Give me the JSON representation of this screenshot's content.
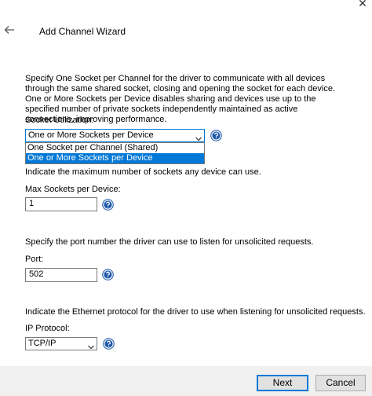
{
  "window": {
    "close_glyph": "✕"
  },
  "header": {
    "title": "Add Channel Wizard",
    "back_icon": "back-arrow-icon"
  },
  "socket_description": "Specify One Socket per Channel for the driver to communicate with all devices through the same shared socket, closing and opening the socket for each device. One or More Sockets per Device disables sharing and devices use up to the specified number of private sockets independently maintained as active connections, improving performance.",
  "socket_utilization": {
    "label": "Socket Utilization:",
    "selected": "One or More Sockets per Device",
    "options": [
      "One Socket per Channel (Shared)",
      "One or More Sockets per Device"
    ]
  },
  "max_sockets": {
    "description": "Indicate the maximum number of sockets any device can use.",
    "label": "Max Sockets per Device:",
    "value": "1"
  },
  "port": {
    "description": "Specify the port number the driver can use to listen for unsolicited requests.",
    "label": "Port:",
    "value": "502"
  },
  "ip_protocol": {
    "description": "Indicate the Ethernet protocol for the driver to use when listening for unsolicited requests.",
    "label": "IP Protocol:",
    "selected": "TCP/IP"
  },
  "footer": {
    "next_label": "Next",
    "cancel_label": "Cancel"
  },
  "colors": {
    "accent": "#0078d7",
    "help_icon": "#1e5aa8",
    "footer_bg": "#f0f0f0"
  }
}
